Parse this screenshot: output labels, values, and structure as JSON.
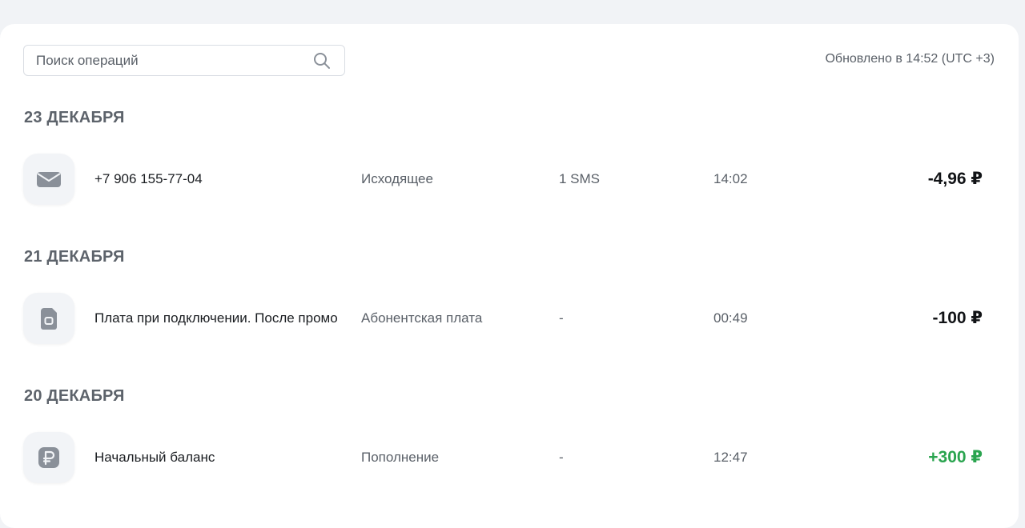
{
  "search": {
    "placeholder": "Поиск операций",
    "icon": "search-icon"
  },
  "updated_text": "Обновлено в 14:52 (UTC +3)",
  "groups": [
    {
      "date": "23 ДЕКАБРЯ",
      "operations": [
        {
          "icon": "envelope-icon",
          "name": "+7 906 155-77-04",
          "type": "Исходящее",
          "quantity": "1 SMS",
          "time": "14:02",
          "amount": "-4,96 ₽",
          "direction": "negative"
        }
      ]
    },
    {
      "date": "21 ДЕКАБРЯ",
      "operations": [
        {
          "icon": "sim-card-icon",
          "name": "Плата при подключении. После промо",
          "type": "Абонентская плата",
          "quantity": "-",
          "time": "00:49",
          "amount": "-100 ₽",
          "direction": "negative"
        }
      ]
    },
    {
      "date": "20 ДЕКАБРЯ",
      "operations": [
        {
          "icon": "ruble-icon",
          "name": "Начальный баланс",
          "type": "Пополнение",
          "quantity": "-",
          "time": "12:47",
          "amount": "+300 ₽",
          "direction": "positive"
        }
      ]
    }
  ],
  "colors": {
    "positive_amount": "#2aa44f",
    "negative_amount": "#111316",
    "icon_fill": "#8a9099"
  }
}
